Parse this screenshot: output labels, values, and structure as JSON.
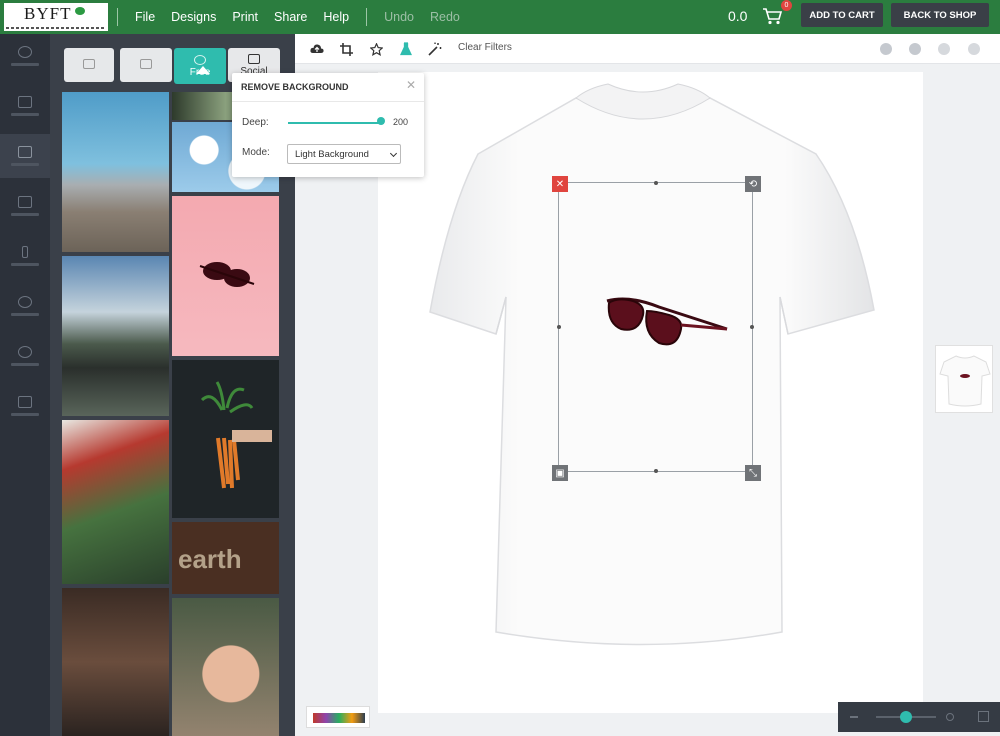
{
  "brand": {
    "name": "BYFT"
  },
  "menu": {
    "file": "File",
    "designs": "Designs",
    "print": "Print",
    "share": "Share",
    "help": "Help",
    "undo": "Undo",
    "redo": "Redo"
  },
  "cart": {
    "price": "0.0",
    "count": "0",
    "add_label": "ADD TO CART",
    "back_label": "BACK TO SHOP"
  },
  "image_tabs": {
    "free": "Free",
    "social": "Social"
  },
  "toolbar": {
    "clear_filters": "Clear Filters"
  },
  "remove_bg": {
    "title": "REMOVE BACKGROUND",
    "deep_label": "Deep:",
    "deep_value": "200",
    "mode_label": "Mode:",
    "mode_value": "Light Background"
  },
  "colors": {
    "brand": "#2b7d3f",
    "accent": "#2fbcae",
    "rail": "#2c313a",
    "delete": "#e0453f"
  }
}
